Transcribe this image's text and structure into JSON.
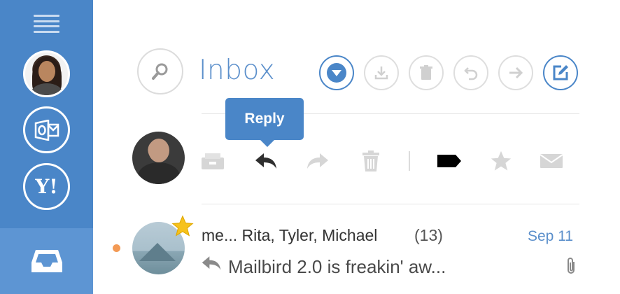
{
  "sidebar": {
    "menu_icon": "hamburger-icon",
    "accounts": [
      {
        "name": "user-avatar",
        "icon": "person-avatar"
      },
      {
        "name": "outlook-account",
        "icon": "outlook-icon",
        "label": "O"
      },
      {
        "name": "yahoo-account",
        "icon": "yahoo-icon",
        "label": "Y!"
      }
    ],
    "inbox_icon": "inbox-tray-icon",
    "colors": {
      "background": "#4a86c8",
      "active": "#5d95d3"
    }
  },
  "header": {
    "title": "Inbox",
    "buttons": [
      "search-icon",
      "dropdown-icon",
      "download-icon",
      "trash-icon",
      "undo-icon",
      "forward-icon",
      "compose-icon"
    ],
    "accent": "#5b8fcb"
  },
  "tooltip": {
    "text": "Reply"
  },
  "action_bar": {
    "buttons": [
      "archive-icon",
      "reply-icon",
      "forward-icon",
      "delete-icon",
      "tag-icon",
      "star-icon",
      "mail-icon"
    ]
  },
  "message": {
    "participants": "me... Rita, Tyler, Michael",
    "count": "(13)",
    "date": "Sep 11",
    "subject": "Mailbird 2.0 is freakin' aw...",
    "starred": true,
    "unread": true,
    "has_attachment": true,
    "colors": {
      "unread_dot": "#f39a55",
      "star": "#f6c21c"
    }
  }
}
